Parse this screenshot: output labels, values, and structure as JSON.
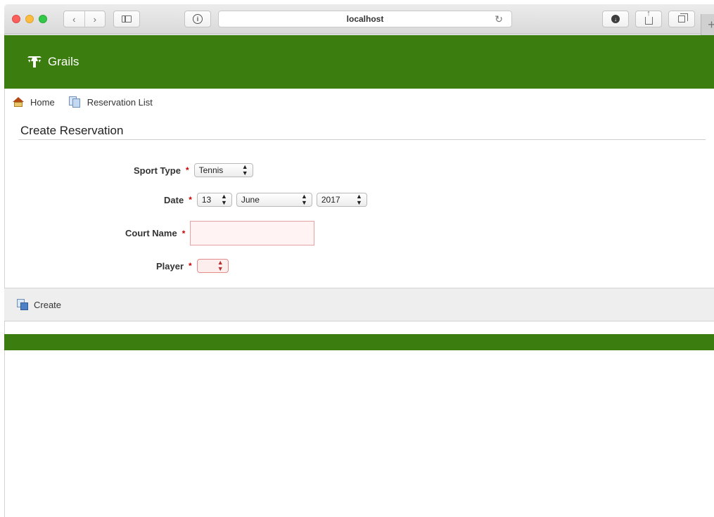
{
  "browser": {
    "url": "localhost",
    "icons": [
      "back-icon",
      "forward-icon",
      "sidebar-icon",
      "privacy-icon",
      "reload-icon",
      "download-icon",
      "share-icon",
      "tabs-icon",
      "new-tab-icon"
    ],
    "back_glyph": "‹",
    "forward_glyph": "›",
    "reload_glyph": "↻",
    "plus_glyph": "+"
  },
  "header": {
    "brand": "Grails",
    "color": "#3b7d0f"
  },
  "nav": {
    "home": "Home",
    "reservation_list": "Reservation List"
  },
  "page": {
    "title": "Create Reservation"
  },
  "form": {
    "sport_type": {
      "label": "Sport Type",
      "value": "Tennis"
    },
    "date": {
      "label": "Date",
      "day": "13",
      "month": "June",
      "year": "2017"
    },
    "court_name": {
      "label": "Court Name",
      "value": ""
    },
    "player": {
      "label": "Player",
      "value": ""
    },
    "required_marker": "*"
  },
  "actions": {
    "create": "Create"
  },
  "colors": {
    "required": "#cc0000",
    "error_border": "#e7a1a1",
    "error_bg": "#fff3f3"
  }
}
